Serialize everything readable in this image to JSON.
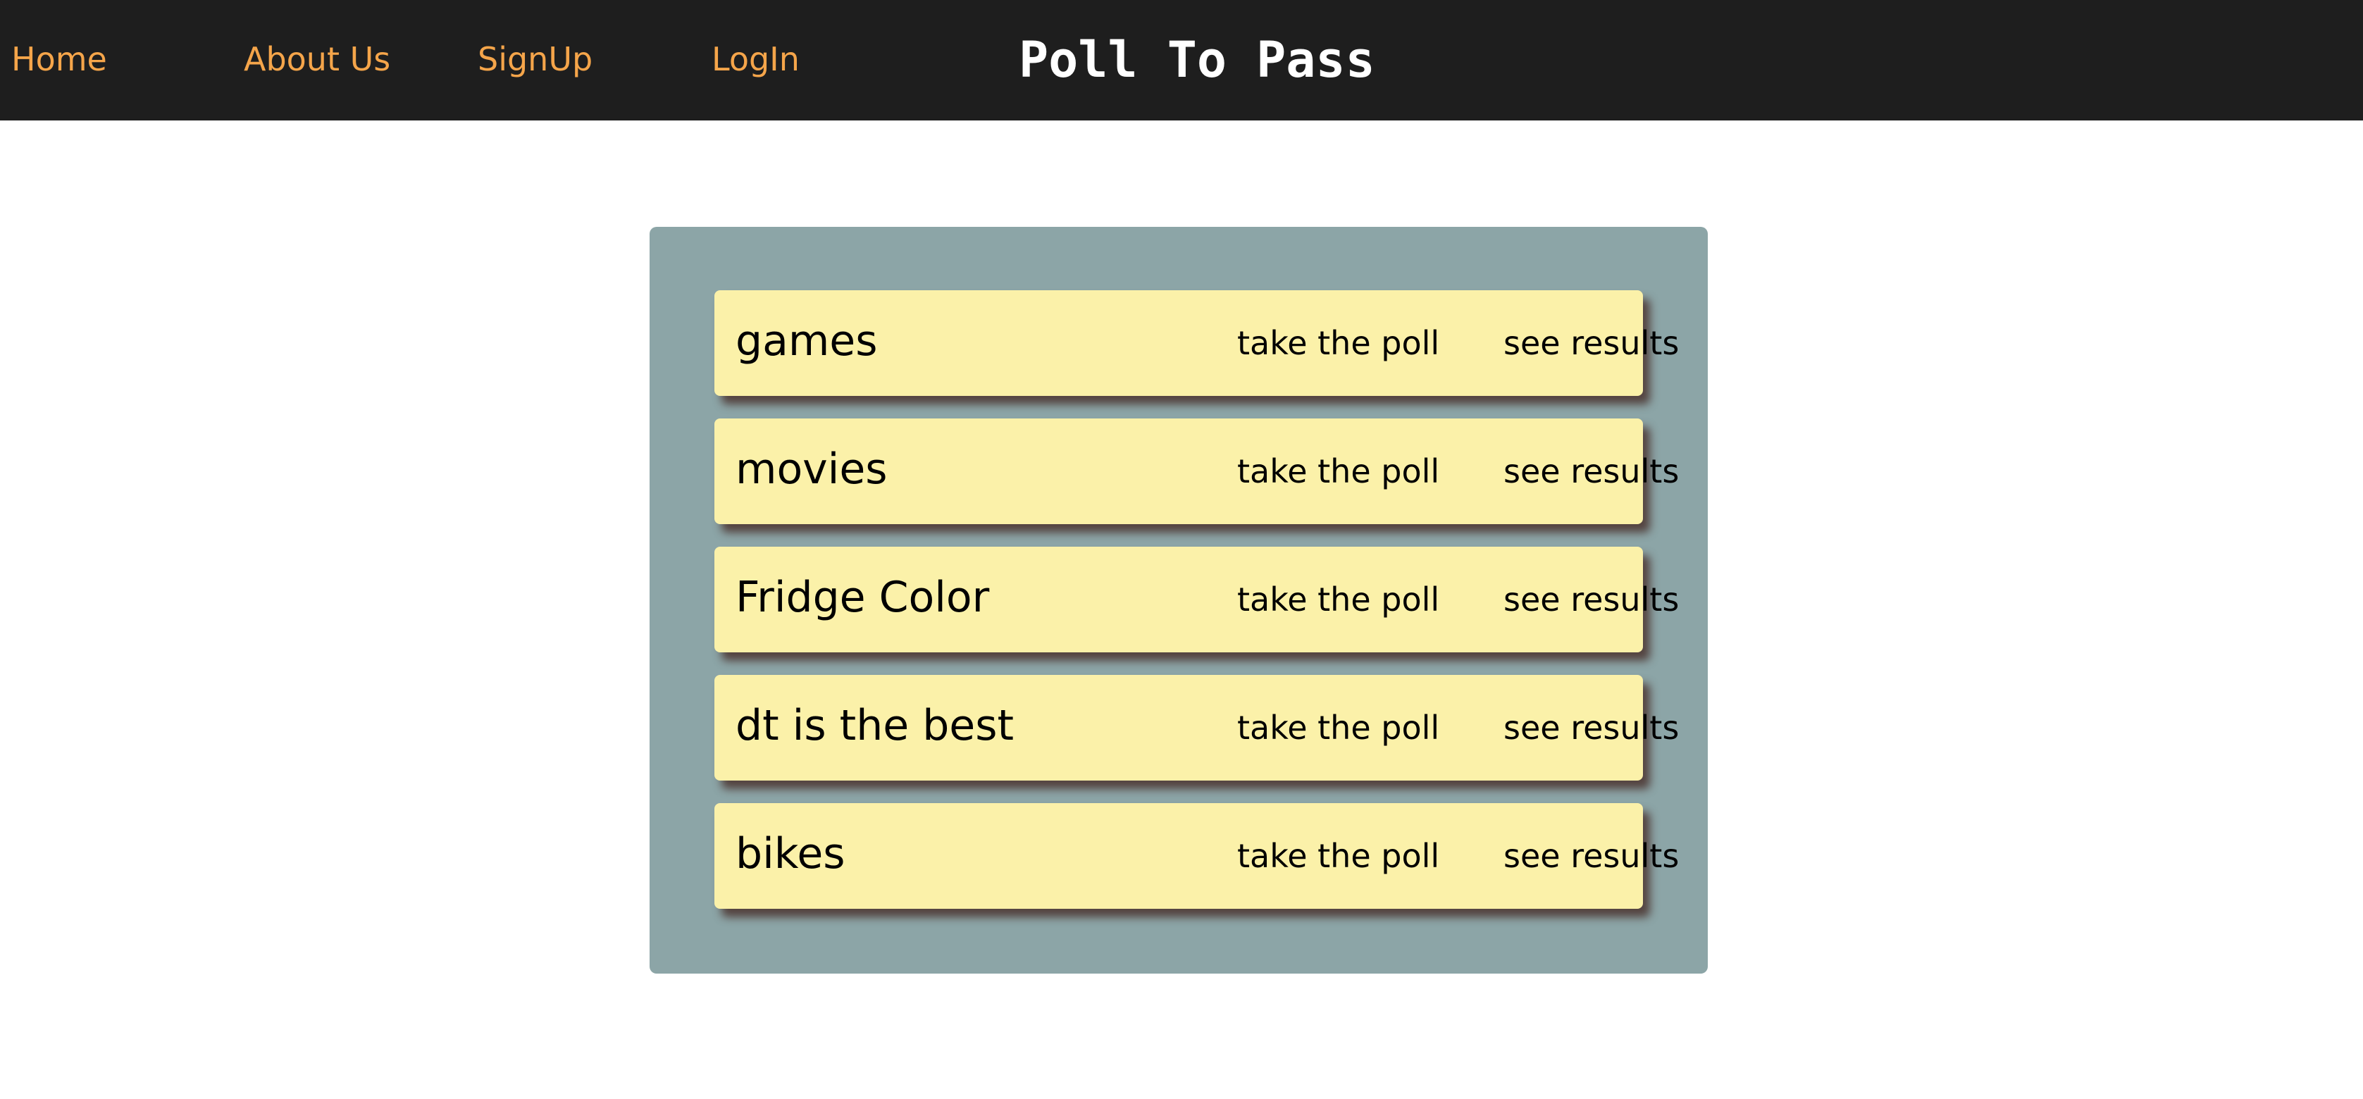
{
  "nav": {
    "home": "Home",
    "about": "About Us",
    "signup": "SignUp",
    "login": "LogIn",
    "site_title": "Poll To Pass"
  },
  "polls": [
    {
      "name": "games",
      "take_label": "take the poll",
      "results_label": "see results"
    },
    {
      "name": "movies",
      "take_label": "take the poll",
      "results_label": "see results"
    },
    {
      "name": "Fridge Color",
      "take_label": "take the poll",
      "results_label": "see results"
    },
    {
      "name": "dt is the best",
      "take_label": "take the poll",
      "results_label": "see results"
    },
    {
      "name": "bikes",
      "take_label": "take the poll",
      "results_label": "see results"
    }
  ],
  "colors": {
    "navbar_bg": "#1e1e1e",
    "nav_link": "#f5a54a",
    "panel_bg": "#8ca5a7",
    "card_bg": "#fbf1a9"
  }
}
